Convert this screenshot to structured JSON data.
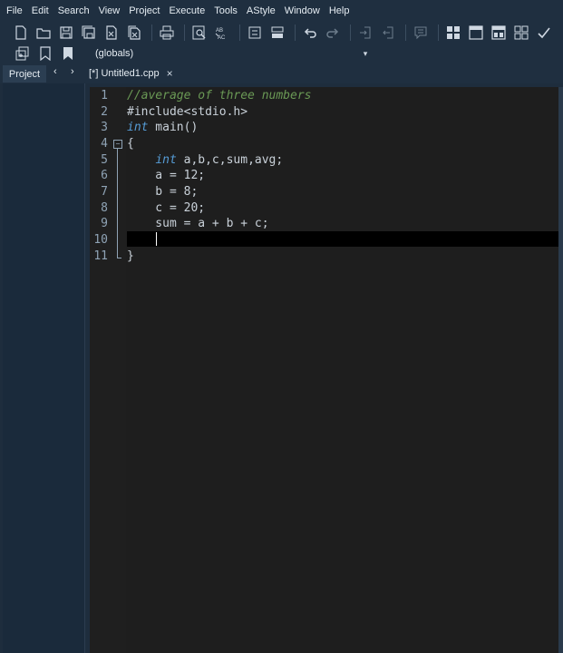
{
  "menu": [
    "File",
    "Edit",
    "Search",
    "View",
    "Project",
    "Execute",
    "Tools",
    "AStyle",
    "Window",
    "Help"
  ],
  "toolbar1": [
    {
      "name": "new-file-icon"
    },
    {
      "name": "open-folder-icon"
    },
    {
      "name": "save-icon"
    },
    {
      "name": "save-all-icon"
    },
    {
      "name": "close-file-icon"
    },
    {
      "name": "close-all-icon"
    },
    {
      "name": "print-icon"
    },
    {
      "name": "find-icon"
    },
    {
      "name": "replace-icon"
    },
    {
      "name": "goto-line-icon"
    },
    {
      "name": "split-icon"
    },
    {
      "name": "undo-icon"
    },
    {
      "name": "redo-icon"
    },
    {
      "name": "indent-icon"
    },
    {
      "name": "unindent-icon"
    },
    {
      "name": "toggle-comment-icon"
    },
    {
      "name": "layout-grid-icon"
    },
    {
      "name": "layout-window-icon"
    },
    {
      "name": "layout-panel-icon"
    },
    {
      "name": "layout-tiles-icon"
    },
    {
      "name": "check-icon"
    }
  ],
  "globals": {
    "value": "(globals)"
  },
  "tabs": {
    "project_label": "Project",
    "prev": "‹",
    "next": "›",
    "file_tab_label": "[*] Untitled1.cpp",
    "close": "×"
  },
  "editor": {
    "lines": [
      {
        "num": "1",
        "text": "//average of three numbers"
      },
      {
        "num": "2",
        "text": "#include<stdio.h>"
      },
      {
        "num": "3",
        "text": "int main()"
      },
      {
        "num": "4",
        "text": "{"
      },
      {
        "num": "5",
        "text": "    int a,b,c,sum,avg;"
      },
      {
        "num": "6",
        "text": "    a = 12;"
      },
      {
        "num": "7",
        "text": "    b = 8;"
      },
      {
        "num": "8",
        "text": "    c = 20;"
      },
      {
        "num": "9",
        "text": "    sum = a + b + c;"
      },
      {
        "num": "10",
        "text": ""
      },
      {
        "num": "11",
        "text": "}"
      }
    ]
  },
  "colors": {
    "background": "#1e2d3d",
    "editor": "#1e1e1e",
    "comment": "#6a9955",
    "keyword": "#569cd6",
    "text": "#c9d1d9"
  }
}
